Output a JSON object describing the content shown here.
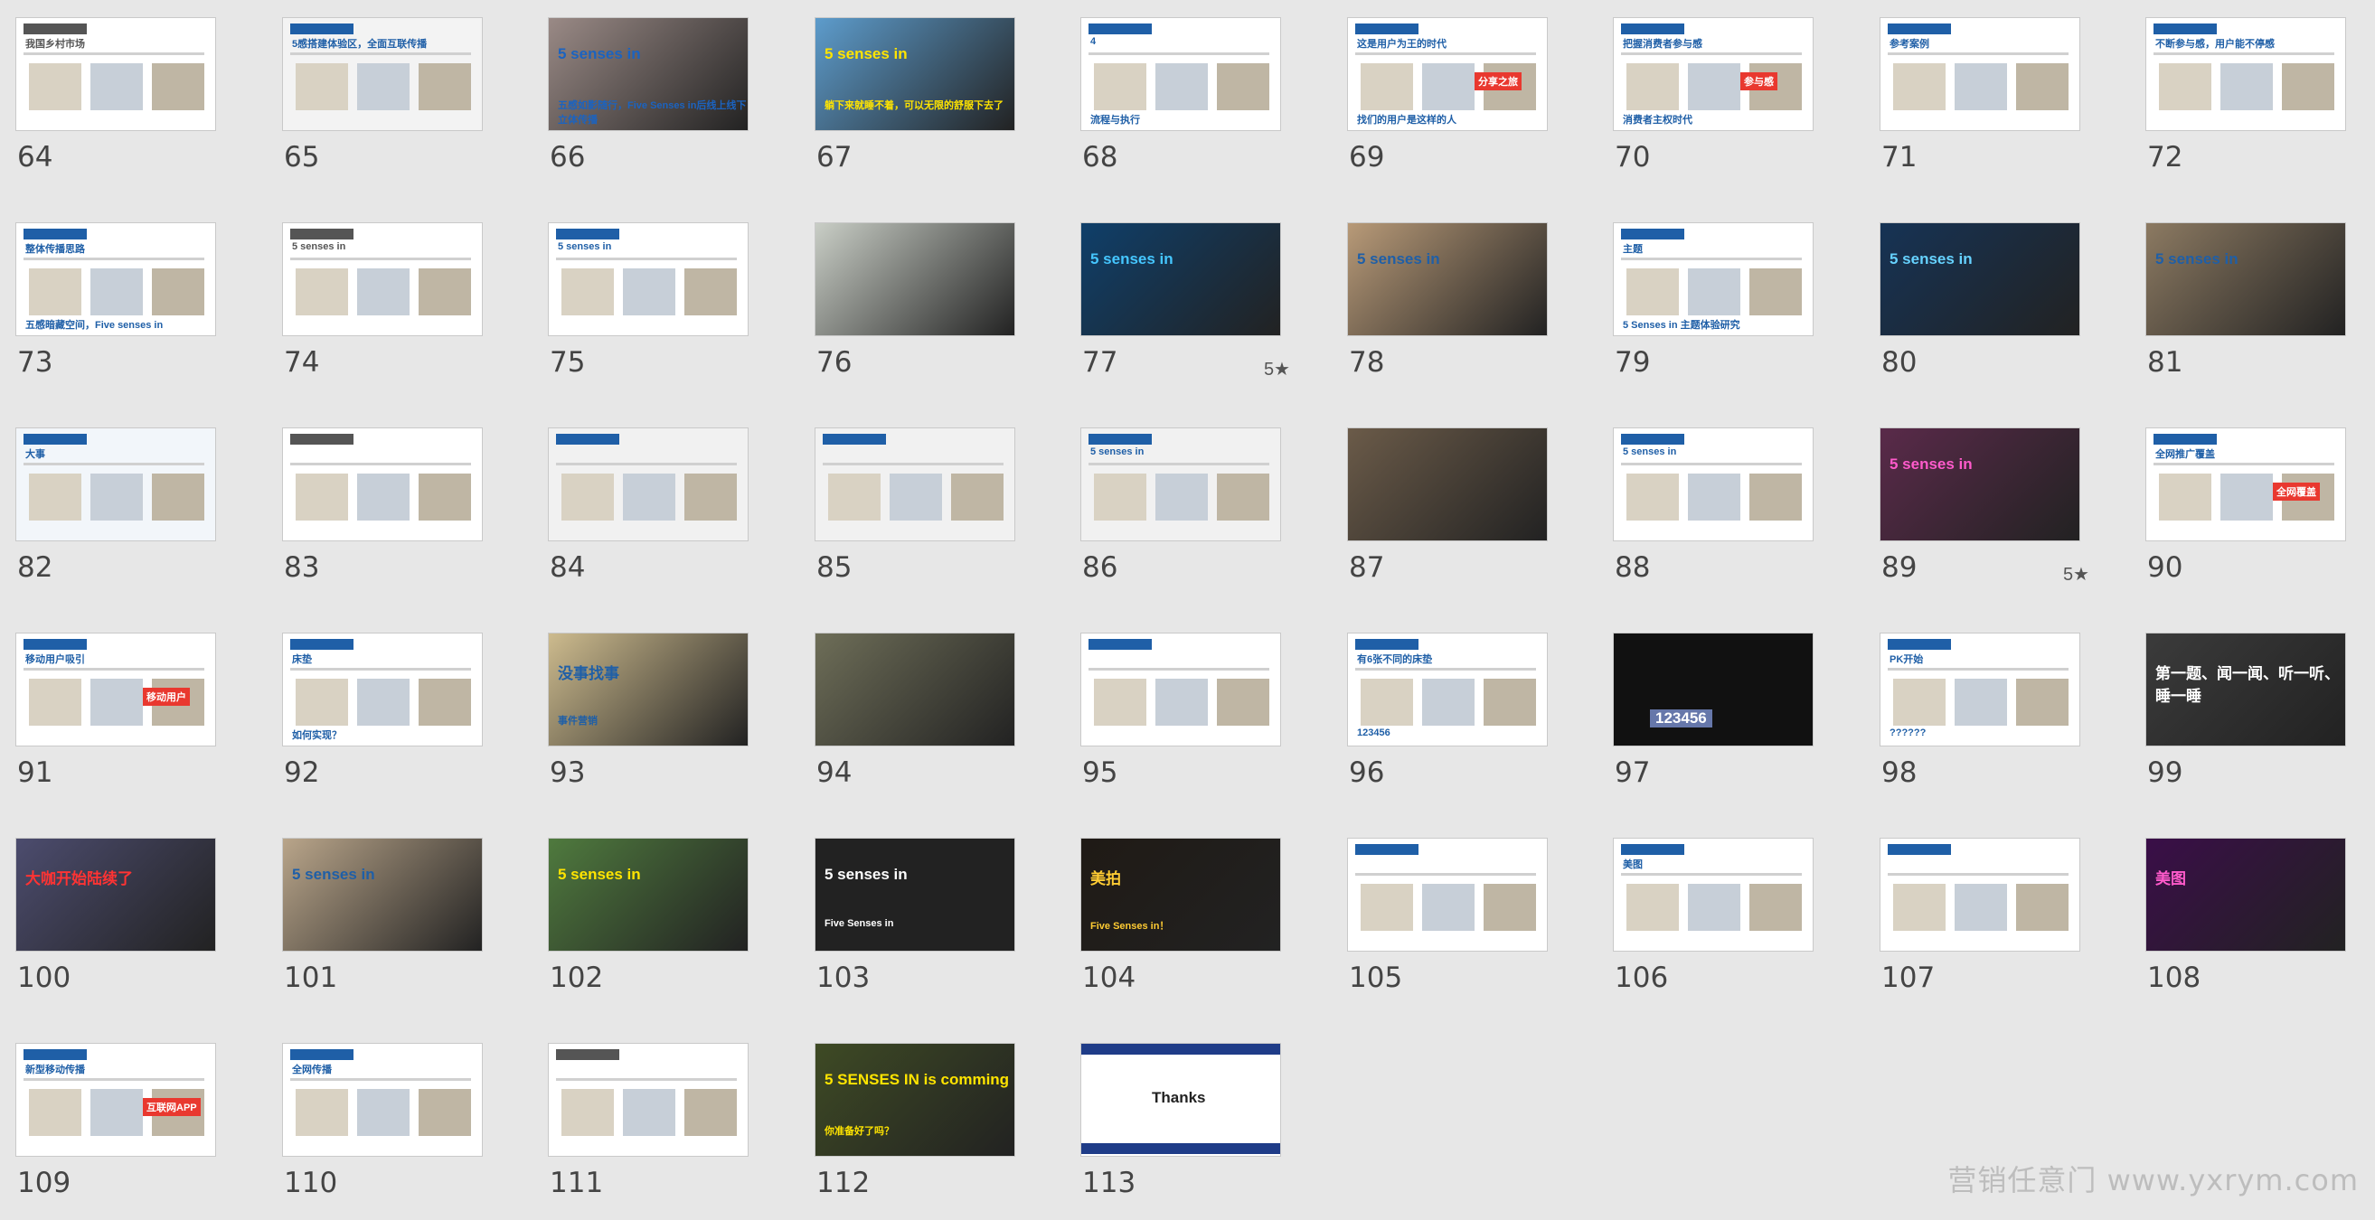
{
  "slides": [
    {
      "n": "64",
      "theme": "doc",
      "bg": "#ffffff",
      "accent": "#555555",
      "title": "我国乡村市场"
    },
    {
      "n": "65",
      "theme": "light",
      "bg": "#f3f3f3",
      "accent": "#1f5fa7",
      "title": "5感搭建体验区，全面互联传播"
    },
    {
      "n": "66",
      "theme": "photo",
      "bg": "#9a8a86",
      "accent": "#1b63c0",
      "title": "5 senses in",
      "sub": "五感如影随行，Five Senses in后线上线下立体传播"
    },
    {
      "n": "67",
      "theme": "photo",
      "bg": "#5d9ccc",
      "accent": "#ffe400",
      "title": "5 senses in",
      "sub": "躺下来就睡不着，可以无限的舒服下去了"
    },
    {
      "n": "68",
      "theme": "light",
      "bg": "#ffffff",
      "accent": "#1f5fa7",
      "title": "4",
      "sub": "流程与执行"
    },
    {
      "n": "69",
      "theme": "doc",
      "bg": "#ffffff",
      "accent": "#1f5fa7",
      "title": "这是用户为王的时代",
      "sub": "找们的用户是这样的人",
      "badge": "分享之旅"
    },
    {
      "n": "70",
      "theme": "doc",
      "bg": "#ffffff",
      "accent": "#1f5fa7",
      "title": "把握消费者参与感",
      "sub": "消费者主权时代",
      "badge": "参与感"
    },
    {
      "n": "71",
      "theme": "doc",
      "bg": "#ffffff",
      "accent": "#1f5fa7",
      "title": "参考案例"
    },
    {
      "n": "72",
      "theme": "doc",
      "bg": "#ffffff",
      "accent": "#1f5fa7",
      "title": "不断参与感，用户能不停感"
    },
    {
      "n": "73",
      "theme": "doc",
      "bg": "#ffffff",
      "accent": "#1f5fa7",
      "title": "整体传播思路",
      "sub": "五感暗藏空间，Five senses in"
    },
    {
      "n": "74",
      "theme": "doc",
      "bg": "#ffffff",
      "accent": "#555555",
      "title": "5 senses in"
    },
    {
      "n": "75",
      "theme": "doc",
      "bg": "#ffffff",
      "accent": "#1f5fa7",
      "title": "5 senses in"
    },
    {
      "n": "76",
      "theme": "photo",
      "bg": "#c9cec6",
      "accent": "#ffffff",
      "title": ""
    },
    {
      "n": "77",
      "theme": "photo",
      "bg": "#0f3f6a",
      "accent": "#45c6ff",
      "title": "5 senses in",
      "star": "5★"
    },
    {
      "n": "78",
      "theme": "photo",
      "bg": "#b89a78",
      "accent": "#1f5fa7",
      "title": "5 senses in"
    },
    {
      "n": "79",
      "theme": "doc",
      "bg": "#ffffff",
      "accent": "#1f5fa7",
      "title": "主题",
      "sub": "5 Senses in 主题体验研究"
    },
    {
      "n": "80",
      "theme": "photo",
      "bg": "#163355",
      "accent": "#66d2ff",
      "title": "5 senses in"
    },
    {
      "n": "81",
      "theme": "photo",
      "bg": "#8c7a62",
      "accent": "#1f5fa7",
      "title": "5 senses in"
    },
    {
      "n": "82",
      "theme": "doc",
      "bg": "#f2f6fa",
      "accent": "#1f5fa7",
      "title": "大事"
    },
    {
      "n": "83",
      "theme": "doc",
      "bg": "#ffffff",
      "accent": "#555555",
      "title": ""
    },
    {
      "n": "84",
      "theme": "light",
      "bg": "#f1f1f1",
      "accent": "#1f5fa7",
      "title": ""
    },
    {
      "n": "85",
      "theme": "light",
      "bg": "#f1f1f1",
      "accent": "#1f5fa7",
      "title": ""
    },
    {
      "n": "86",
      "theme": "light",
      "bg": "#f1f1f1",
      "accent": "#1f5fa7",
      "title": "5 senses in"
    },
    {
      "n": "87",
      "theme": "photo",
      "bg": "#6b5b49",
      "accent": "#1f5fa7",
      "title": ""
    },
    {
      "n": "88",
      "theme": "doc",
      "bg": "#ffffff",
      "accent": "#1f5fa7",
      "title": "5 senses in"
    },
    {
      "n": "89",
      "theme": "photo",
      "bg": "#5a2a4a",
      "accent": "#ff5acb",
      "title": "5 senses in",
      "star": "5★"
    },
    {
      "n": "90",
      "theme": "doc",
      "bg": "#ffffff",
      "accent": "#1f5fa7",
      "title": "全网推广覆盖",
      "badge": "全网覆盖"
    },
    {
      "n": "91",
      "theme": "doc",
      "bg": "#ffffff",
      "accent": "#1f5fa7",
      "title": "移动用户吸引",
      "badge": "移动用户"
    },
    {
      "n": "92",
      "theme": "doc",
      "bg": "#ffffff",
      "accent": "#1f5fa7",
      "title": "床垫",
      "sub": "如何实现？"
    },
    {
      "n": "93",
      "theme": "photo",
      "bg": "#cdbb8e",
      "accent": "#1f5fa7",
      "title": "没事找事",
      "sub": "事件营销"
    },
    {
      "n": "94",
      "theme": "photo",
      "bg": "#6e6e58",
      "accent": "#1f5fa7",
      "title": ""
    },
    {
      "n": "95",
      "theme": "doc",
      "bg": "#ffffff",
      "accent": "#1f5fa7",
      "title": ""
    },
    {
      "n": "96",
      "theme": "doc",
      "bg": "#ffffff",
      "accent": "#1f5fa7",
      "title": "有6张不同的床垫",
      "sub": "123456"
    },
    {
      "n": "97",
      "theme": "dark",
      "bg": "#111111",
      "accent": "#6677aa",
      "title": "",
      "sub": "123456"
    },
    {
      "n": "98",
      "theme": "doc",
      "bg": "#ffffff",
      "accent": "#1f5fa7",
      "title": "PK开始",
      "sub": "??????"
    },
    {
      "n": "99",
      "theme": "photo",
      "bg": "#3b3b3b",
      "accent": "#ffffff",
      "title": "第一题、闻一闻、听一听、睡一睡"
    },
    {
      "n": "100",
      "theme": "photo",
      "bg": "#4c4c6e",
      "accent": "#ff3333",
      "title": "大咖开始陆续了"
    },
    {
      "n": "101",
      "theme": "photo",
      "bg": "#b9a58a",
      "accent": "#1f5fa7",
      "title": "5 senses in"
    },
    {
      "n": "102",
      "theme": "photo",
      "bg": "#4f7a3e",
      "accent": "#ffe400",
      "title": "5 senses in"
    },
    {
      "n": "103",
      "theme": "photo",
      "bg": "#222222",
      "accent": "#ffffff",
      "title": "5 senses in",
      "sub": "Five Senses in"
    },
    {
      "n": "104",
      "theme": "photo",
      "bg": "#1f1a15",
      "accent": "#ffcc33",
      "title": "美拍",
      "sub": "Five Senses in！"
    },
    {
      "n": "105",
      "theme": "doc",
      "bg": "#ffffff",
      "accent": "#1f5fa7",
      "title": ""
    },
    {
      "n": "106",
      "theme": "doc",
      "bg": "#ffffff",
      "accent": "#1f5fa7",
      "title": "美图"
    },
    {
      "n": "107",
      "theme": "doc",
      "bg": "#ffffff",
      "accent": "#1f5fa7",
      "title": ""
    },
    {
      "n": "108",
      "theme": "photo",
      "bg": "#3a0e48",
      "accent": "#ff5acb",
      "title": "美图"
    },
    {
      "n": "109",
      "theme": "doc",
      "bg": "#ffffff",
      "accent": "#1f5fa7",
      "title": "新型移动传播",
      "badge": "互联网APP"
    },
    {
      "n": "110",
      "theme": "doc",
      "bg": "#ffffff",
      "accent": "#1f5fa7",
      "title": "全网传播"
    },
    {
      "n": "111",
      "theme": "doc",
      "bg": "#ffffff",
      "accent": "#555555",
      "title": ""
    },
    {
      "n": "112",
      "theme": "photo",
      "bg": "#3e4a24",
      "accent": "#ffe400",
      "title": "5 SENSES IN is comming",
      "sub": "你准备好了吗？"
    },
    {
      "n": "113",
      "theme": "thanks",
      "bg": "#ffffff",
      "accent": "#1f3c88",
      "title": "Thanks"
    }
  ],
  "watermark": "营销任意门 www.yxrym.com"
}
